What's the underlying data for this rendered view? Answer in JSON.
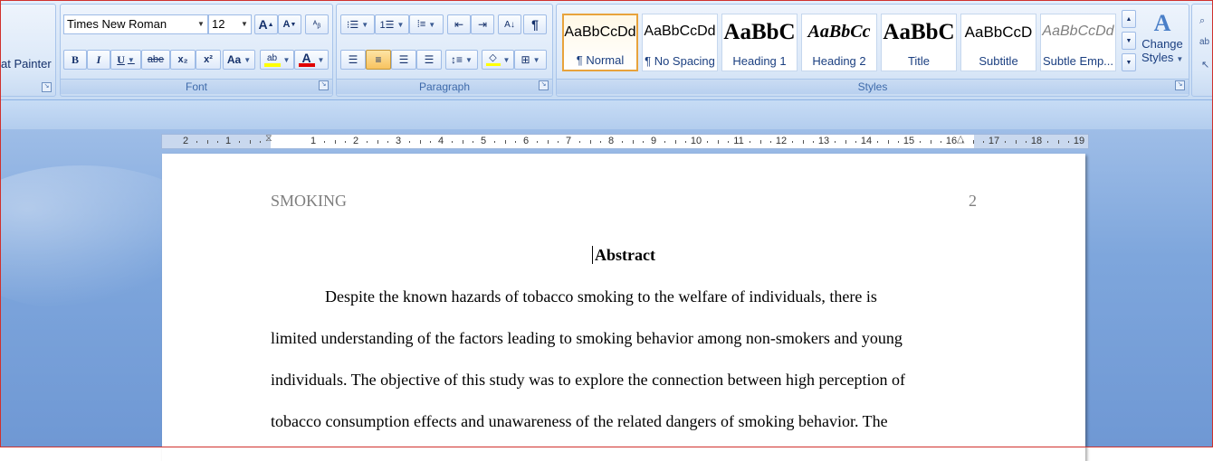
{
  "ribbon": {
    "clipboard": {
      "format_painter": "at Painter"
    },
    "font": {
      "label": "Font",
      "font_name": "Times New Roman",
      "font_size": "12",
      "grow": "A",
      "shrink": "A",
      "clear": "ᴬᵦ",
      "bold": "B",
      "italic": "I",
      "underline": "U",
      "strike": "abe",
      "subscript": "x₂",
      "superscript": "x²",
      "change_case": "Aa",
      "highlight": "ab",
      "font_color": "A"
    },
    "paragraph": {
      "label": "Paragraph",
      "show_marks": "¶",
      "sort": "A↓"
    },
    "styles": {
      "label": "Styles",
      "tiles": [
        {
          "sample": "AaBbCcDd",
          "name": "¶ Normal"
        },
        {
          "sample": "AaBbCcDd",
          "name": "¶ No Spacing"
        },
        {
          "sample": "AaBbC",
          "name": "Heading 1"
        },
        {
          "sample": "AaBbCc",
          "name": "Heading 2"
        },
        {
          "sample": "AaBbC",
          "name": "Title"
        },
        {
          "sample": "AaBbCcD",
          "name": "Subtitle"
        },
        {
          "sample": "AaBbCcDd",
          "name": "Subtle Emp..."
        }
      ],
      "change_styles_line1": "Change",
      "change_styles_line2": "Styles"
    }
  },
  "ruler": {
    "labels": [
      "2",
      "1",
      "1",
      "2",
      "3",
      "4",
      "5",
      "6",
      "7",
      "8",
      "9",
      "10",
      "11",
      "12",
      "13",
      "14",
      "15",
      "16",
      "17",
      "18",
      "19"
    ]
  },
  "document": {
    "header_left": "SMOKING",
    "header_right": "2",
    "title": "Abstract",
    "lines": [
      "Despite the known hazards of tobacco smoking to the welfare of individuals, there is",
      "limited understanding of the factors leading to smoking behavior among non-smokers and young",
      "individuals. The objective of this study was to explore the connection between high perception of",
      "tobacco consumption effects and unawareness of the related dangers of smoking behavior. The"
    ]
  },
  "colors": {
    "accent": "#15428b",
    "highlight_yellow": "#ffff00",
    "font_red": "#e00000",
    "selected_border": "#e8a33c"
  }
}
